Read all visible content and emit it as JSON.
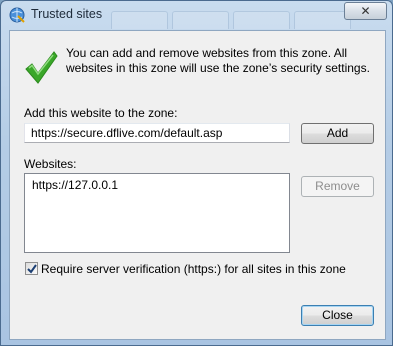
{
  "window": {
    "title": "Trusted sites",
    "close_glyph": "✕"
  },
  "info": {
    "text": "You can add and remove websites from this zone. All websites in this zone will use the zone’s security settings.",
    "icon": "green-checkmark-icon"
  },
  "add_site": {
    "label": "Add this website to the zone:",
    "value": "https://secure.dflive.com/default.asp",
    "button_label": "Add"
  },
  "websites": {
    "label": "Websites:",
    "items": [
      "https://127.0.0.1"
    ],
    "remove_label": "Remove"
  },
  "require_verification": {
    "label": "Require server verification (https:) for all sites in this zone",
    "checked": true
  },
  "footer": {
    "close_label": "Close"
  },
  "colors": {
    "check_green": "#3aa729",
    "title_bar": "#b5cde6"
  }
}
